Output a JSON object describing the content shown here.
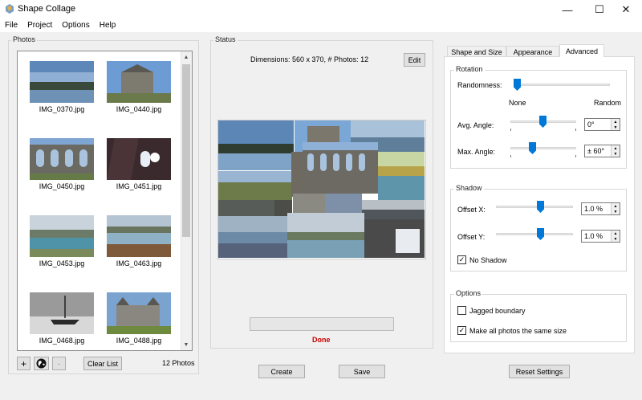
{
  "window": {
    "title": "Shape Collage",
    "minimize": "—",
    "maximize": "☐",
    "close": "✕"
  },
  "menu": [
    "File",
    "Project",
    "Options",
    "Help"
  ],
  "photos": {
    "group_label": "Photos",
    "items": [
      {
        "name": "IMG_0370.jpg"
      },
      {
        "name": "IMG_0440.jpg"
      },
      {
        "name": "IMG_0450.jpg"
      },
      {
        "name": "IMG_0451.jpg"
      },
      {
        "name": "IMG_0453.jpg"
      },
      {
        "name": "IMG_0463.jpg"
      },
      {
        "name": "IMG_0468.jpg"
      },
      {
        "name": "IMG_0488.jpg"
      }
    ],
    "add_label": "+",
    "remove_label": "-",
    "clear_label": "Clear List",
    "count": "12 Photos"
  },
  "status": {
    "group_label": "Status",
    "info": "Dimensions: 560 x 370, # Photos: 12",
    "edit_label": "Edit",
    "done": "Done",
    "progress": 0,
    "done_color": "#cc0000"
  },
  "actions": {
    "create": "Create",
    "save": "Save",
    "reset": "Reset Settings"
  },
  "tabs": [
    {
      "label": "Shape and Size",
      "active": false
    },
    {
      "label": "Appearance",
      "active": false
    },
    {
      "label": "Advanced",
      "active": true
    }
  ],
  "rotation": {
    "group_label": "Rotation",
    "randomness_label": "Randomness:",
    "randomness_value": 0,
    "none_label": "None",
    "random_label": "Random",
    "avg_angle_label": "Avg. Angle:",
    "avg_angle_value": "0°",
    "max_angle_label": "Max. Angle:",
    "max_angle_value": "± 60°"
  },
  "shadow": {
    "group_label": "Shadow",
    "offset_x_label": "Offset X:",
    "offset_x_value": "1.0 %",
    "offset_y_label": "Offset Y:",
    "offset_y_value": "1.0 %",
    "no_shadow_label": "No Shadow",
    "no_shadow_checked": true
  },
  "options": {
    "group_label": "Options",
    "jagged_label": "Jagged boundary",
    "jagged_checked": false,
    "same_size_label": "Make all photos the same size",
    "same_size_checked": true
  },
  "colors": {
    "accent": "#0078d7",
    "done_text": "#cc0000"
  }
}
